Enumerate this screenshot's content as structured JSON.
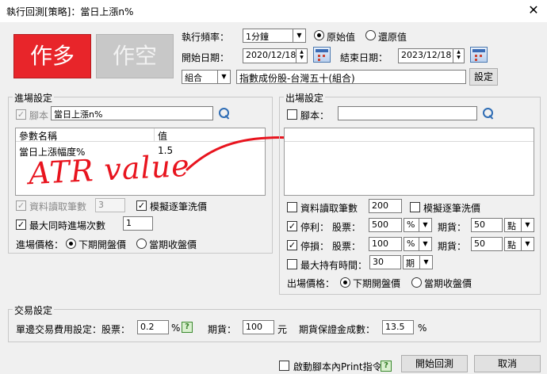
{
  "window": {
    "title": "執行回測[策略]：當日上漲n%",
    "close": "✕"
  },
  "entry_long": {
    "label": "作多"
  },
  "entry_short": {
    "label": "作空"
  },
  "frequency": {
    "label": "執行頻率：",
    "value": "1分鐘",
    "opt_original": "原始值",
    "opt_restore": "還原值",
    "selected": "原始值"
  },
  "dates": {
    "start_label": "開始日期：",
    "start_value": "2020/12/18",
    "end_label": "結束日期：",
    "end_value": "2023/12/18"
  },
  "symbol": {
    "type_value": "組合",
    "name": "指數成份股-台灣五十(組合)",
    "settings_button": "設定"
  },
  "entry": {
    "group_title": "進場設定",
    "script_label": "腳本",
    "script_value": "當日上漲n%",
    "script_checked": true,
    "param_headers": [
      "參數名稱",
      "值"
    ],
    "params": [
      {
        "name": "當日上漲幅度%",
        "value": "1.5"
      }
    ],
    "annotation": "ATR value",
    "read_data_label": "資料讀取筆數",
    "read_data_value": "3",
    "read_data_checked": true,
    "simulate_label": "模擬逐筆洗價",
    "simulate_checked": true,
    "max_entries_label": "最大同時進場次數",
    "max_entries_value": "1",
    "max_entries_checked": true,
    "price_label": "進場價格：",
    "price_opt1": "下期開盤價",
    "price_opt2": "當期收盤價",
    "price_selected": "下期開盤價"
  },
  "exit": {
    "group_title": "出場設定",
    "script_label": "腳本：",
    "script_value": "",
    "script_checked": false,
    "read_data_label": "資料讀取筆數",
    "read_data_value": "200",
    "read_data_checked": false,
    "simulate_label": "模擬逐筆洗價",
    "simulate_checked": false,
    "take_profit": {
      "label": "停利：",
      "stock_label": "股票：",
      "stock_value": "500",
      "stock_unit": "%",
      "futures_label": "期貨：",
      "futures_value": "50",
      "futures_unit": "點",
      "checked": true
    },
    "stop_loss": {
      "label": "停損：",
      "stock_label": "股票：",
      "stock_value": "100",
      "stock_unit": "%",
      "futures_label": "期貨：",
      "futures_value": "50",
      "futures_unit": "點",
      "checked": true
    },
    "max_hold_label": "最大持有時間：",
    "max_hold_value": "30",
    "max_hold_unit": "期",
    "max_hold_checked": false,
    "price_label": "出場價格：",
    "price_opt1": "下期開盤價",
    "price_opt2": "當期收盤價",
    "price_selected": "下期開盤價"
  },
  "trade": {
    "group_title": "交易設定",
    "fee_label": "單邊交易費用設定：股票：",
    "fee_stock_value": "0.2",
    "fee_stock_unit": "%",
    "fee_futures_label": "期貨：",
    "fee_futures_value": "100",
    "fee_futures_unit": "元",
    "margin_label": "期貨保證金成數：",
    "margin_value": "13.5",
    "margin_unit": "%",
    "help": "?"
  },
  "footer": {
    "print_label": "啟動腳本內Print指令",
    "print_checked": false,
    "start_button": "開始回測",
    "cancel_button": "取消"
  },
  "colors": {
    "long_button": "#e8252a",
    "short_button_disabled": "#c8c8c8",
    "annotation": "#e8141e"
  }
}
